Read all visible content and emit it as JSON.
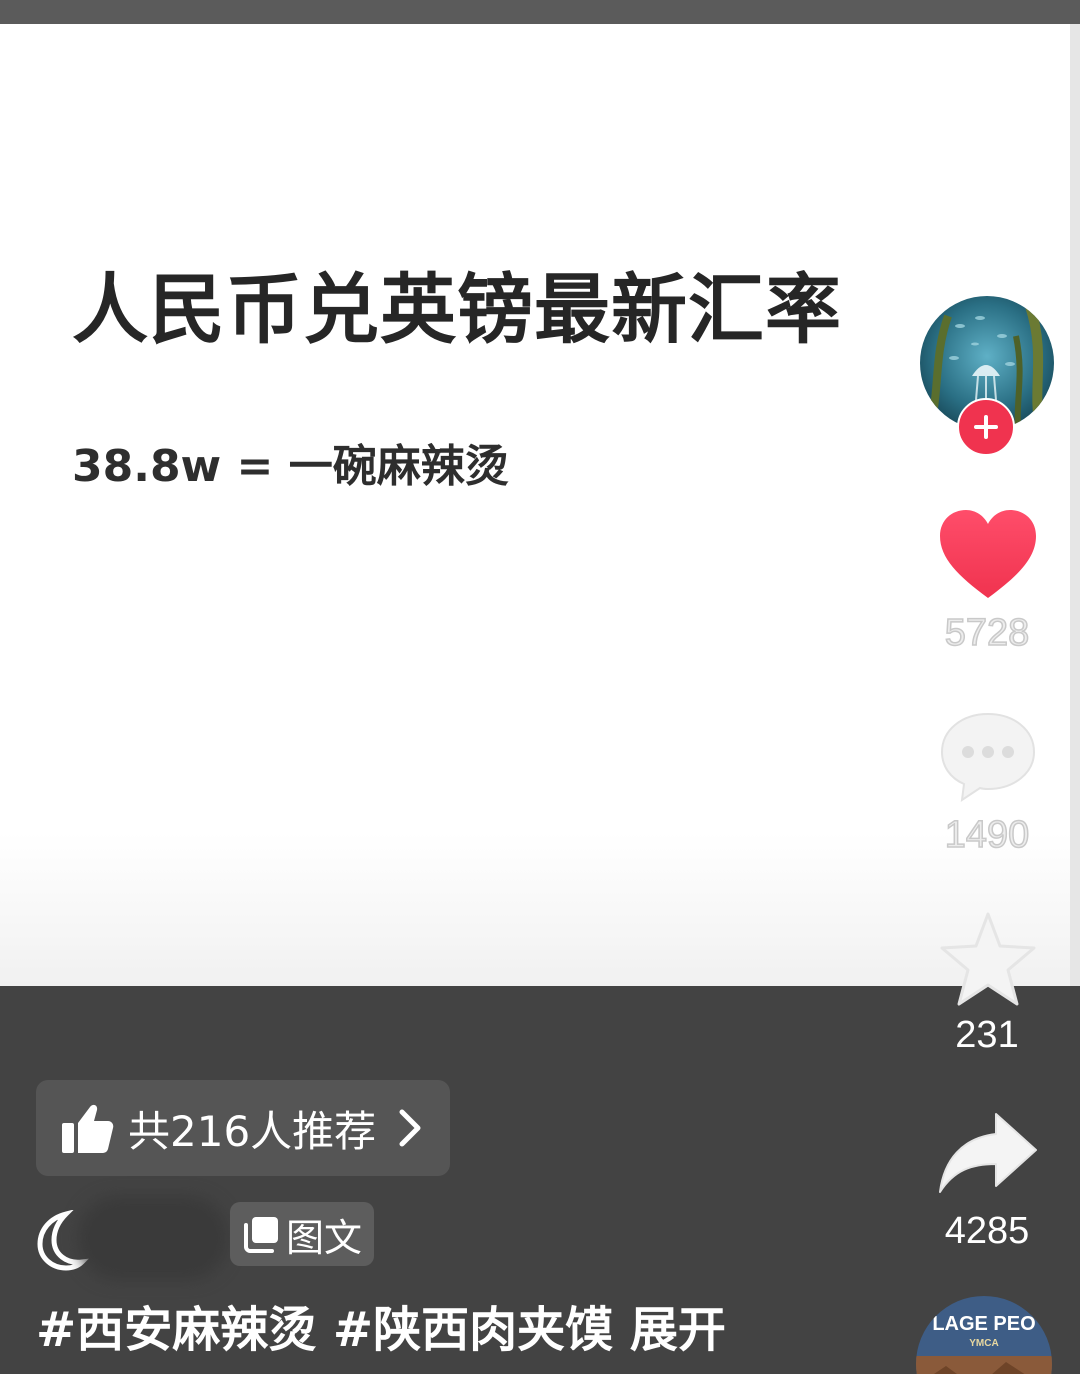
{
  "post": {
    "title": "人民币兑英镑最新汇率",
    "subtitle": "38.8w  = 一碗麻辣烫"
  },
  "actions": {
    "like_count": "5728",
    "comment_count": "1490",
    "favorite_count": "231",
    "share_count": "4285"
  },
  "recommend": {
    "label": "共216人推荐"
  },
  "author": {
    "post_type_label": "图文"
  },
  "caption": {
    "text": "#西安麻辣烫 #陕西肉夹馍  展开"
  },
  "music_disc": {
    "label": "LAGE PEO",
    "sublabel": "YMCA"
  },
  "colors": {
    "accent": "#f0334f",
    "bottom_bg": "#434343",
    "chip_bg": "#555555"
  },
  "icons": [
    "plus-icon",
    "heart-icon",
    "comment-icon",
    "star-icon",
    "share-icon",
    "thumbs-up-icon",
    "chevron-right-icon",
    "moon-icon",
    "image-text-icon"
  ]
}
